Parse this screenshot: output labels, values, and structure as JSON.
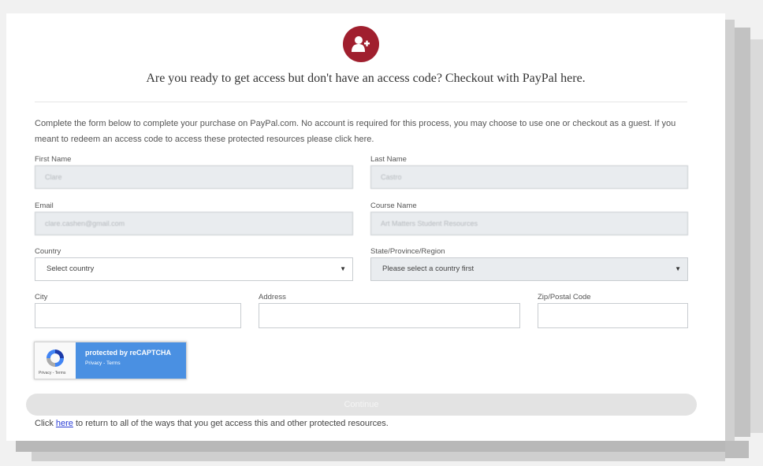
{
  "header": {
    "title": "Are you ready to get access but don't have an access code? Checkout with PayPal here.",
    "icon": "add-user-icon",
    "accent": "#a01f2e"
  },
  "intro": {
    "text": "Complete the form below to complete your purchase on PayPal.com. No account is required for this process, you may choose to use one or checkout as a guest. If you meant to redeem an access code to access these protected resources please click here."
  },
  "form": {
    "first_name": {
      "label": "First Name",
      "value": "Clare"
    },
    "last_name": {
      "label": "Last Name",
      "value": "Castro"
    },
    "email": {
      "label": "Email",
      "value": "clare.cashen@gmail.com"
    },
    "course_name": {
      "label": "Course Name",
      "value": "Art Matters Student Resources"
    },
    "country": {
      "label": "Country",
      "value": "Select country"
    },
    "state": {
      "label": "State/Province/Region",
      "value": "Please select a country first"
    },
    "city": {
      "label": "City",
      "value": ""
    },
    "address": {
      "label": "Address",
      "value": ""
    },
    "zip": {
      "label": "Zip/Postal Code",
      "value": ""
    }
  },
  "captcha": {
    "title": "protected by reCAPTCHA",
    "links": "Privacy - Terms",
    "small": "Privacy - Terms",
    "color": "#4a90e2"
  },
  "continue_label": "Continue",
  "footer": {
    "before": "Click ",
    "link": "here",
    "after": " to return to all of the ways that you get access this and other protected resources."
  }
}
